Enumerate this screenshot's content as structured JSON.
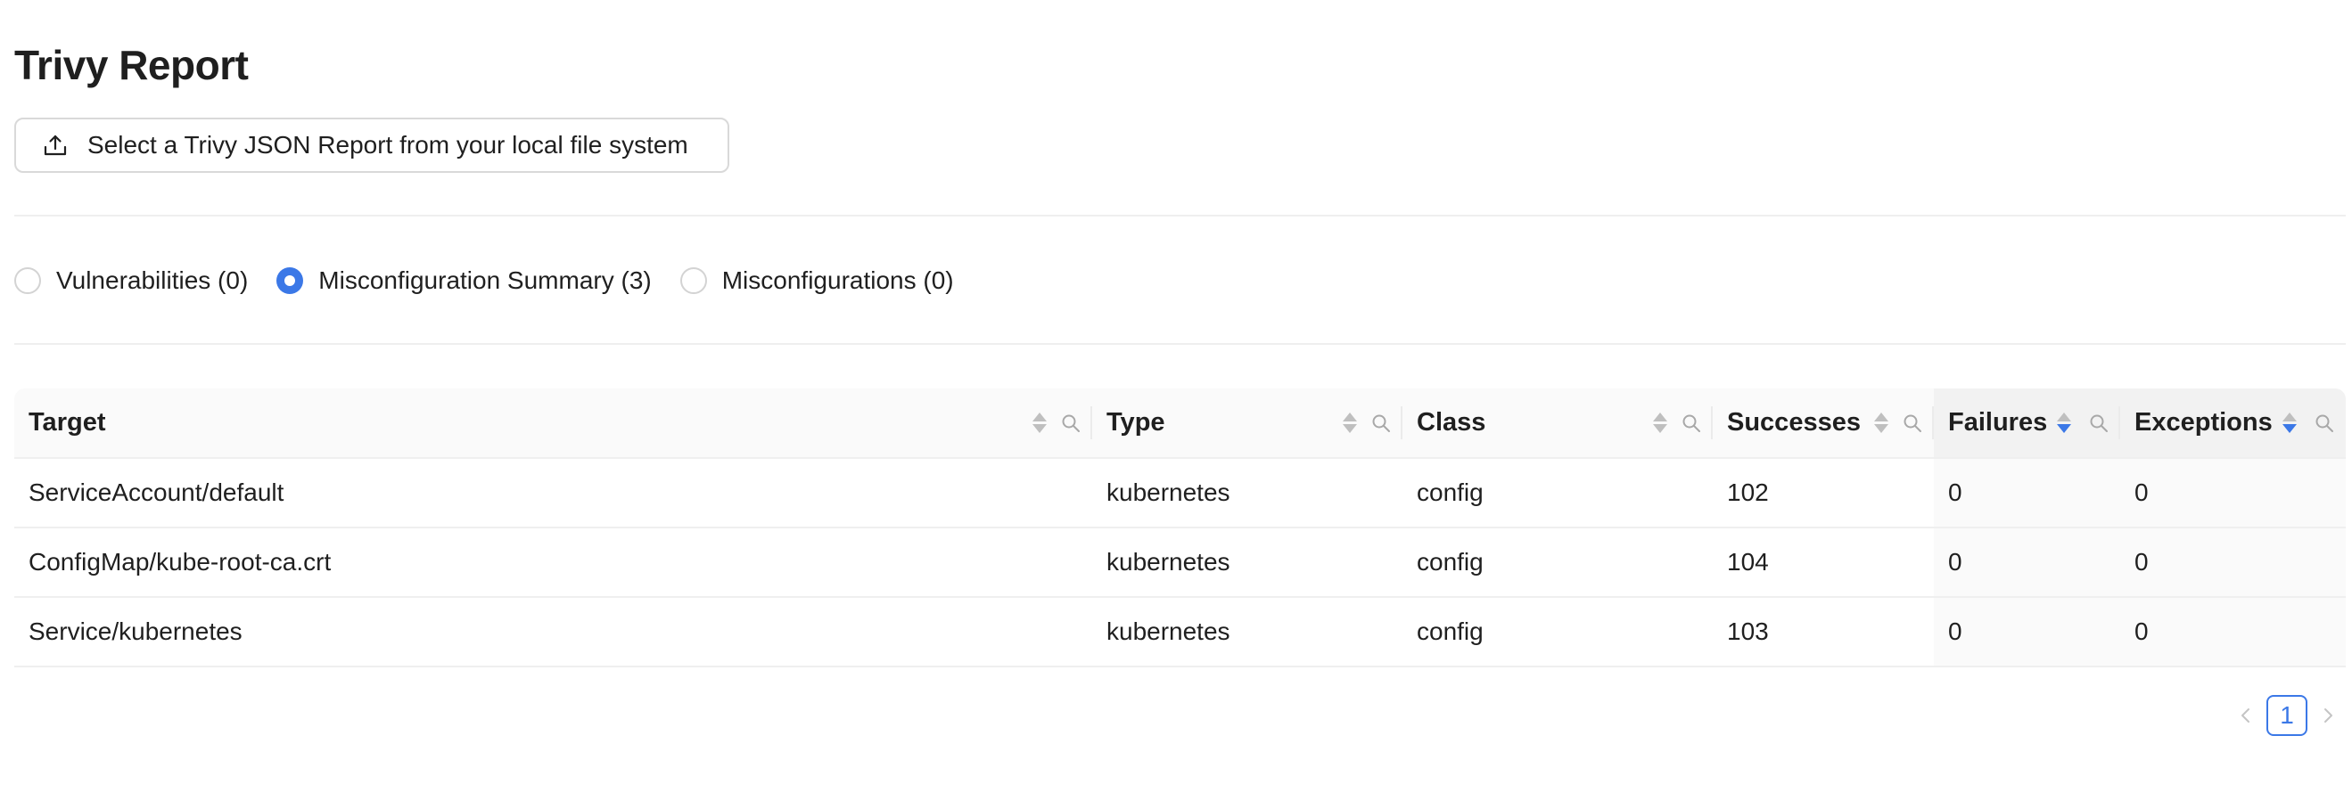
{
  "header": {
    "title": "Trivy Report"
  },
  "upload": {
    "label": "Select a Trivy JSON Report from your local file system",
    "icon": "upload-icon"
  },
  "views": [
    {
      "label": "Vulnerabilities (0)",
      "checked": false
    },
    {
      "label": "Misconfiguration Summary (3)",
      "checked": true
    },
    {
      "label": "Misconfigurations (0)",
      "checked": false
    }
  ],
  "table": {
    "columns": [
      "Target",
      "Type",
      "Class",
      "Successes",
      "Failures",
      "Exceptions"
    ],
    "rows": [
      [
        "ServiceAccount/default",
        "kubernetes",
        "config",
        "102",
        "0",
        "0"
      ],
      [
        "ConfigMap/kube-root-ca.crt",
        "kubernetes",
        "config",
        "104",
        "0",
        "0"
      ],
      [
        "Service/kubernetes",
        "kubernetes",
        "config",
        "103",
        "0",
        "0"
      ]
    ]
  },
  "pagination": {
    "current": "1",
    "prev_icon": "chevron-left-icon",
    "next_icon": "chevron-right-icon"
  },
  "colors": {
    "accent": "#3b78e7",
    "border": "#d9d9d9",
    "header_bg": "#fafafa"
  }
}
